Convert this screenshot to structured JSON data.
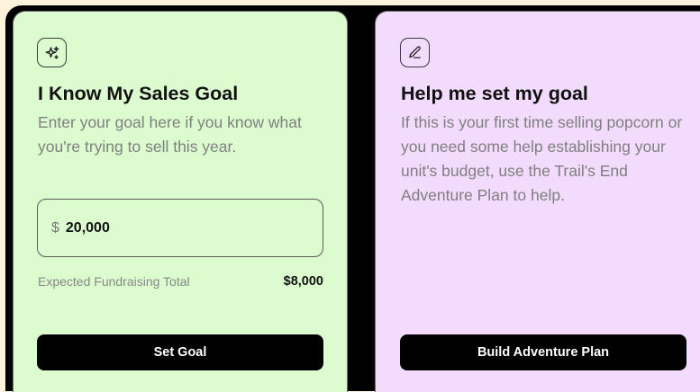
{
  "left_card": {
    "title": "I Know My Sales Goal",
    "description": "Enter your goal here if you know what you're trying to sell this year.",
    "icon": "sparkles-icon",
    "goal_input": {
      "currency": "$",
      "value": "20,000"
    },
    "expected_total_label": "Expected Fundraising Total",
    "expected_total_value": "$8,000",
    "button_label": "Set Goal",
    "background": "#dcfcd0"
  },
  "right_card": {
    "title": "Help me set my goal",
    "description": "If this is your first time selling popcorn or you need some help establishing your unit's budget, use the Trail's End Adventure Plan to help.",
    "icon": "pencil-icon",
    "button_label": "Build Adventure Plan",
    "background": "#f2dbfd"
  }
}
